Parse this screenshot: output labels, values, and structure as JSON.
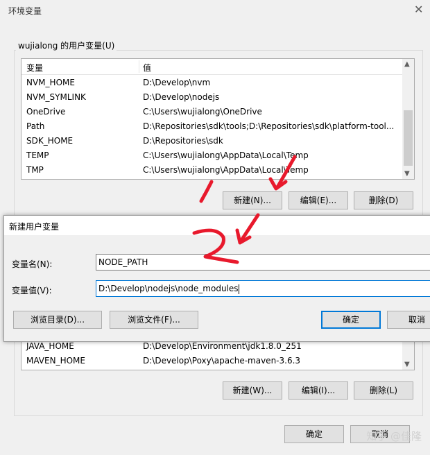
{
  "window": {
    "title": "环境变量"
  },
  "user_vars": {
    "group_label": "wujialong 的用户变量(U)",
    "columns": [
      "变量",
      "值"
    ],
    "rows": [
      {
        "name": "NVM_HOME",
        "value": "D:\\Develop\\nvm"
      },
      {
        "name": "NVM_SYMLINK",
        "value": "D:\\Develop\\nodejs"
      },
      {
        "name": "OneDrive",
        "value": "C:\\Users\\wujialong\\OneDrive"
      },
      {
        "name": "Path",
        "value": "D:\\Repositories\\sdk\\tools;D:\\Repositories\\sdk\\platform-tool..."
      },
      {
        "name": "SDK_HOME",
        "value": "D:\\Repositories\\sdk"
      },
      {
        "name": "TEMP",
        "value": "C:\\Users\\wujialong\\AppData\\Local\\Temp"
      },
      {
        "name": "TMP",
        "value": "C:\\Users\\wujialong\\AppData\\Local\\Temp"
      }
    ],
    "buttons": {
      "new": "新建(N)...",
      "edit": "编辑(E)...",
      "delete": "删除(D)"
    }
  },
  "system_vars": {
    "rows": [
      {
        "name": "JAVA_HOME",
        "value": "D:\\Develop\\Environment\\jdk1.8.0_251"
      },
      {
        "name": "MAVEN_HOME",
        "value": "D:\\Develop\\Poxy\\apache-maven-3.6.3"
      }
    ],
    "buttons": {
      "new": "新建(W)...",
      "edit": "编辑(I)...",
      "delete": "删除(L)"
    }
  },
  "footer": {
    "ok": "确定",
    "cancel": "取消"
  },
  "dialog": {
    "title": "新建用户变量",
    "name_label": "变量名(N):",
    "name_value": "NODE_PATH",
    "value_label": "变量值(V):",
    "value_value": "D:\\Develop\\nodejs\\node_modules",
    "browse_dir": "浏览目录(D)...",
    "browse_file": "浏览文件(F)...",
    "ok": "确定",
    "cancel": "取消"
  },
  "annotation_color": "#e8192c",
  "accent_color": "#0078d7",
  "watermark": "知乎 @佳隆"
}
